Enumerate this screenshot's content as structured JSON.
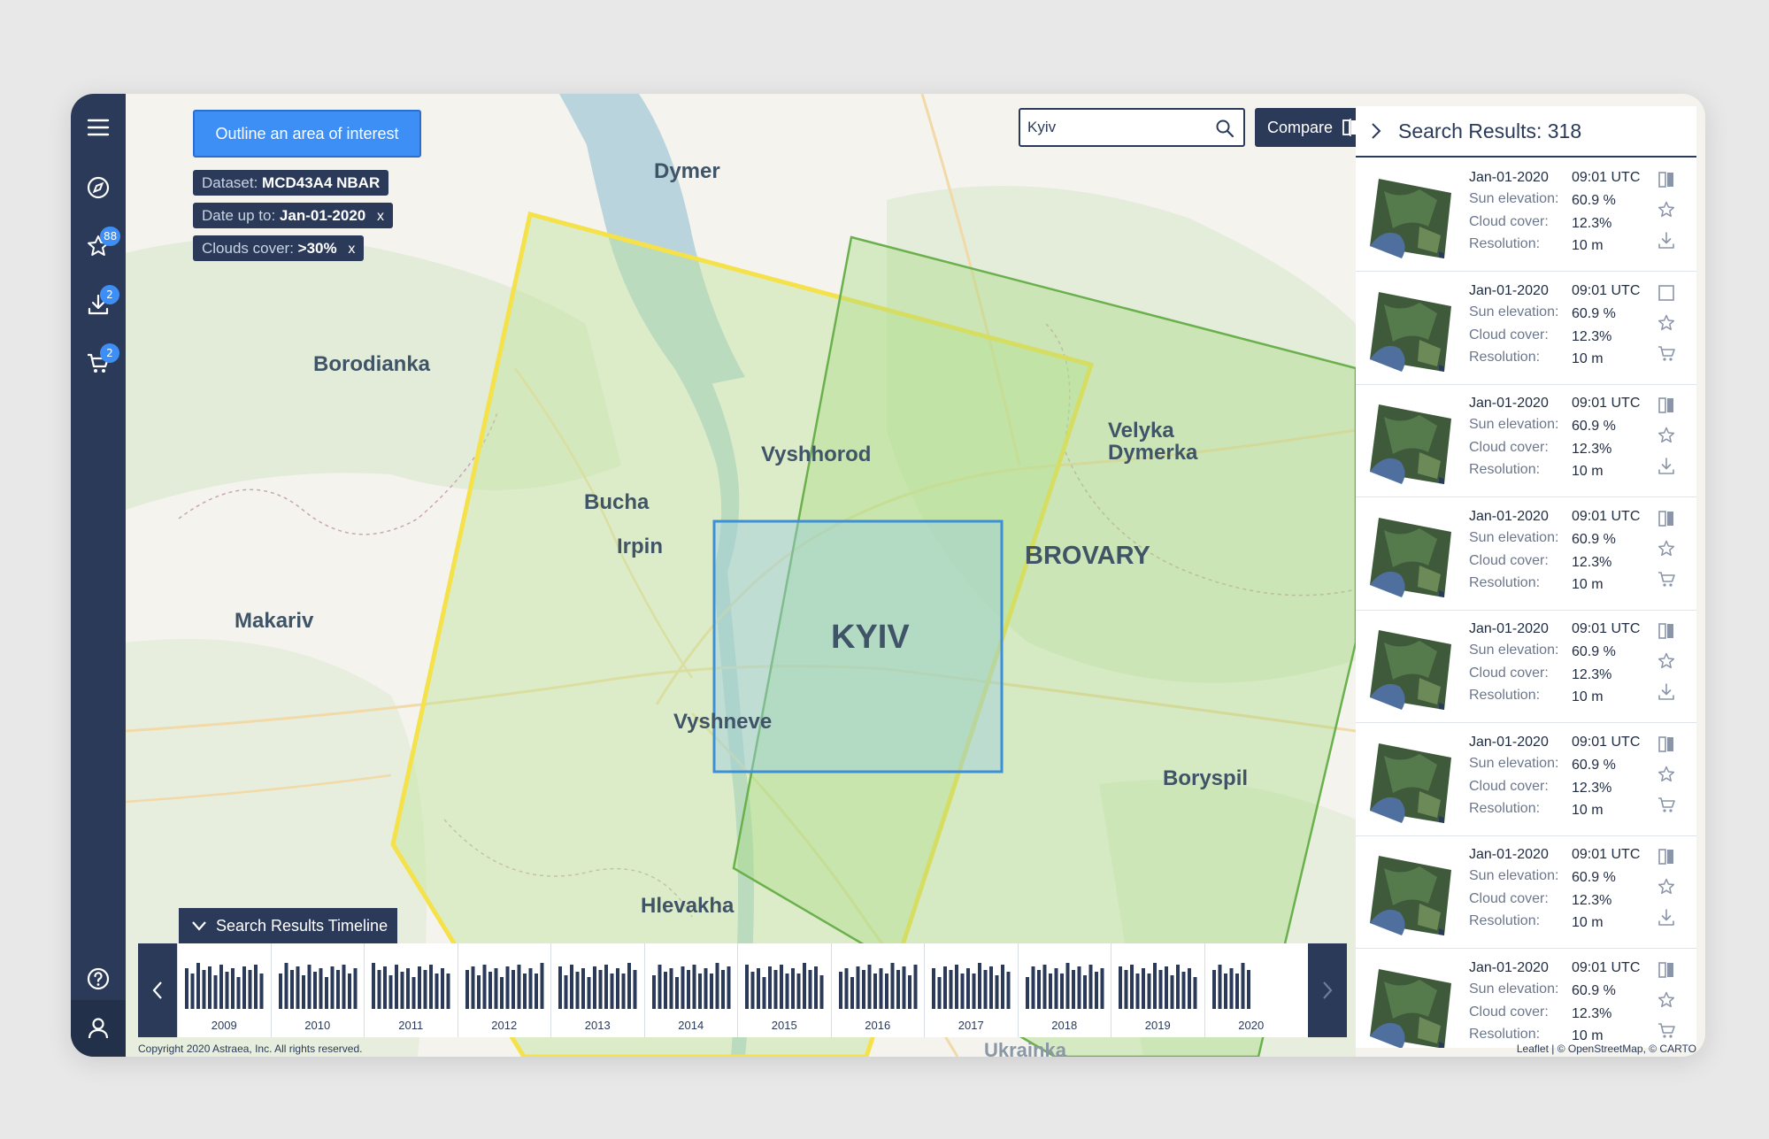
{
  "sidebar": {
    "menu_icon": "hamburger-icon",
    "explore_icon": "compass-icon",
    "favorites_icon": "star-icon",
    "favorites_badge": "88",
    "downloads_icon": "download-icon",
    "downloads_badge": "2",
    "cart_icon": "cart-icon",
    "cart_badge": "2",
    "help_icon": "help-icon",
    "user_icon": "user-icon"
  },
  "toolbar": {
    "aoi_button": "Outline an area of interest",
    "search_value": "Kyiv",
    "search_icon": "search-icon",
    "compare_label": "Compare",
    "compare_icon": "compare-icon",
    "layers_icon": "layers-icon",
    "zoom_in": "+",
    "zoom_out": "−"
  },
  "filters": [
    {
      "label": "Dataset:",
      "value": "MCD43A4 NBAR",
      "removable": false
    },
    {
      "label": "Date up to:",
      "value": "Jan-01-2020",
      "removable": true
    },
    {
      "label": "Clouds cover:",
      "value": ">30%",
      "removable": true
    }
  ],
  "filter_remove": "x",
  "map": {
    "labels": {
      "dymer": "Dymer",
      "borodianka": "Borodianka",
      "vyshhorod": "Vyshhorod",
      "velyka_dymerka": "Velyka\nDymerka",
      "bucha": "Bucha",
      "irpin": "Irpin",
      "brovary": "BROVARY",
      "kyiv": "KYIV",
      "makariv": "Makariv",
      "vyshneve": "Vyshneve",
      "boryspil": "Boryspil",
      "hlevakha": "Hlevakha",
      "ukrainka": "Ukrainka"
    },
    "colors": {
      "yellow_footprint": "#f5e14a",
      "green_footprint": "#6ab04c",
      "aoi": "#3d8fd6",
      "water": "#b9d4dd",
      "land": "#f4f3ee"
    }
  },
  "timeline": {
    "toggle_label": "Search Results Timeline",
    "toggle_icon": "chevron-down-icon",
    "prev_icon": "chevron-left-icon",
    "next_icon": "chevron-right-icon",
    "years": [
      "2009",
      "2010",
      "2011",
      "2012",
      "2013",
      "2014",
      "2015",
      "2016",
      "2017",
      "2018",
      "2019",
      "2020"
    ]
  },
  "footer": {
    "copyright": "Copyright 2020 Astraea, Inc. All rights reserved.",
    "attribution": "Leaflet | © OpenStreetMap, © CARTO"
  },
  "results": {
    "collapse_icon": "chevron-right-icon",
    "title": "Search Results: 318",
    "labels": {
      "sun": "Sun elevation:",
      "cloud": "Cloud cover:",
      "res": "Resolution:"
    },
    "items": [
      {
        "date": "Jan-01-2020",
        "time": "09:01 UTC",
        "sun": "60.9 %",
        "cloud": "12.3%",
        "res": "10 m",
        "icon1": "compare-icon",
        "icon2": "star-icon",
        "icon3": "download-icon"
      },
      {
        "date": "Jan-01-2020",
        "time": "09:01 UTC",
        "sun": "60.9 %",
        "cloud": "12.3%",
        "res": "10 m",
        "icon1": "checkbox-icon",
        "icon2": "star-icon",
        "icon3": "cart-icon"
      },
      {
        "date": "Jan-01-2020",
        "time": "09:01 UTC",
        "sun": "60.9 %",
        "cloud": "12.3%",
        "res": "10 m",
        "icon1": "compare-icon",
        "icon2": "star-icon",
        "icon3": "download-icon"
      },
      {
        "date": "Jan-01-2020",
        "time": "09:01 UTC",
        "sun": "60.9 %",
        "cloud": "12.3%",
        "res": "10 m",
        "icon1": "compare-icon",
        "icon2": "star-icon",
        "icon3": "cart-icon"
      },
      {
        "date": "Jan-01-2020",
        "time": "09:01 UTC",
        "sun": "60.9 %",
        "cloud": "12.3%",
        "res": "10 m",
        "icon1": "compare-icon",
        "icon2": "star-icon",
        "icon3": "download-icon"
      },
      {
        "date": "Jan-01-2020",
        "time": "09:01 UTC",
        "sun": "60.9 %",
        "cloud": "12.3%",
        "res": "10 m",
        "icon1": "compare-icon",
        "icon2": "star-icon",
        "icon3": "cart-icon"
      },
      {
        "date": "Jan-01-2020",
        "time": "09:01 UTC",
        "sun": "60.9 %",
        "cloud": "12.3%",
        "res": "10 m",
        "icon1": "compare-icon",
        "icon2": "star-icon",
        "icon3": "download-icon"
      },
      {
        "date": "Jan-01-2020",
        "time": "09:01 UTC",
        "sun": "60.9 %",
        "cloud": "12.3%",
        "res": "10 m",
        "icon1": "compare-icon",
        "icon2": "star-icon",
        "icon3": "cart-icon"
      }
    ]
  }
}
